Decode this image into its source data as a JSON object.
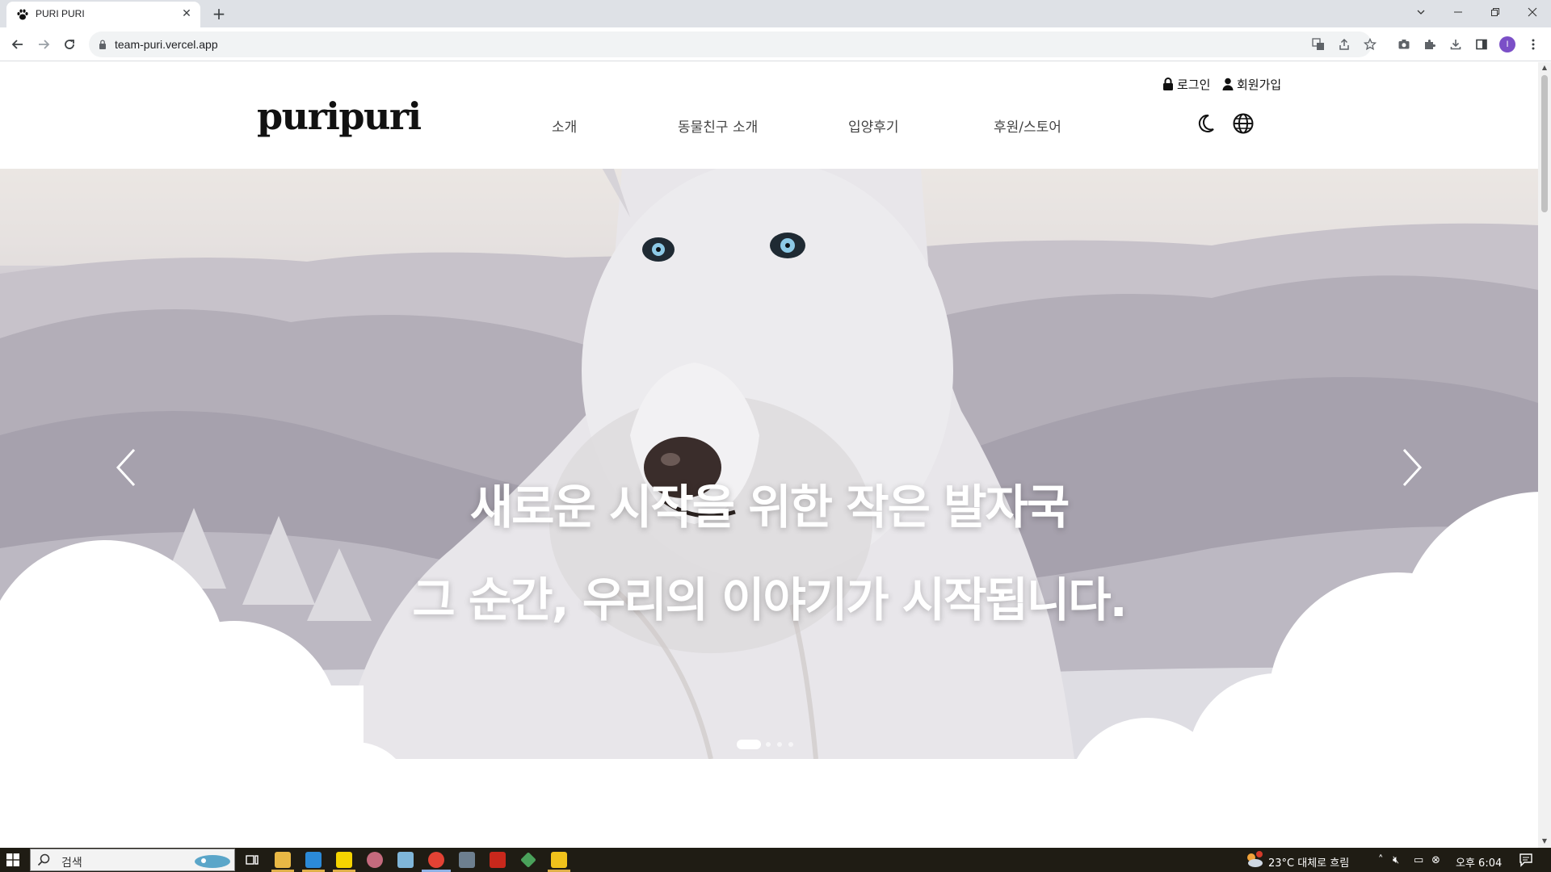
{
  "browser": {
    "tab_title": "PURI PURI",
    "url": "team-puri.vercel.app",
    "profile_initial": "I"
  },
  "header": {
    "login": "로그인",
    "signup": "회원가입",
    "logo": "puripuri",
    "menu": [
      "소개",
      "동물친구 소개",
      "입양후기",
      "후원/스토어"
    ]
  },
  "hero": {
    "line1": "새로운 시작을 위한 작은 발자국",
    "line2": "그 순간, 우리의 이야기가 시작됩니다.",
    "slide_count": 4,
    "active_slide": 1
  },
  "taskbar": {
    "search_placeholder": "검색",
    "weather": "23°C  대체로 흐림",
    "clock": "오후 6:04",
    "weather_badge": "1"
  },
  "colors": {
    "chrome_bg": "#dee1e6",
    "omnibox_bg": "#f1f3f4",
    "taskbar_bg": "#1f1c14",
    "text_dark": "#111111",
    "menu_text": "#444444"
  }
}
